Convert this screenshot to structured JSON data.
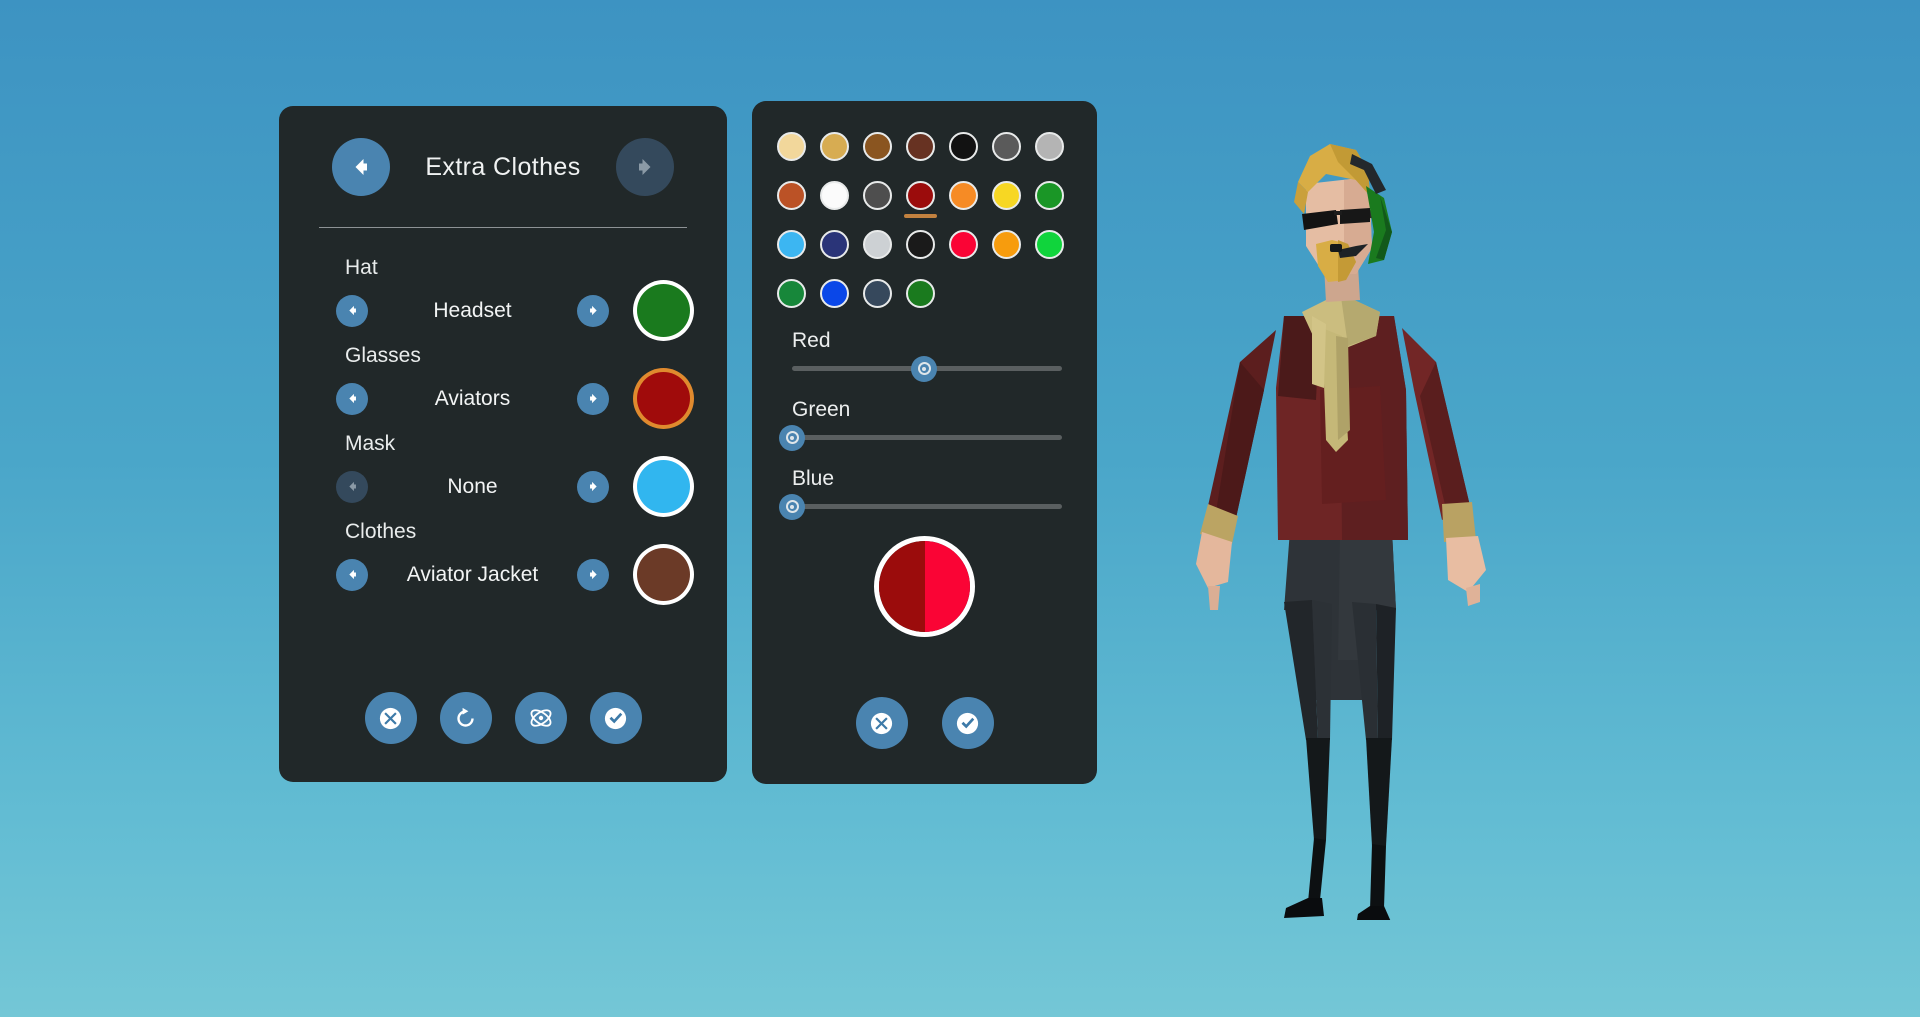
{
  "scene": {
    "background_top": "#3d93c2",
    "background_bottom": "#74c7d6",
    "accent_blue": "#4a84b0",
    "accent_blue_dim": "#34495c",
    "panel_bg": "#212829"
  },
  "clothes_panel": {
    "title": "Extra Clothes",
    "prev_category_icon": "arrow-left-icon",
    "next_category_icon": "arrow-right-icon",
    "prev_category_enabled": true,
    "next_category_enabled": false,
    "groups": [
      {
        "label": "Hat",
        "value": "Headset",
        "swatch": "#1a7a1e",
        "ring": "#ffffff",
        "prev_enabled": true,
        "next_enabled": true
      },
      {
        "label": "Glasses",
        "value": "Aviators",
        "swatch": "#a00b0b",
        "ring": "#e08a2e",
        "prev_enabled": true,
        "next_enabled": true
      },
      {
        "label": "Mask",
        "value": "None",
        "swatch": "#31b6ef",
        "ring": "#ffffff",
        "prev_enabled": false,
        "next_enabled": true
      },
      {
        "label": "Clothes",
        "value": "Aviator Jacket",
        "swatch": "#6b3a27",
        "ring": "#ffffff",
        "prev_enabled": true,
        "next_enabled": true
      }
    ],
    "actions": [
      {
        "name": "cancel-button",
        "icon": "circle-x-icon"
      },
      {
        "name": "reset-button",
        "icon": "refresh-icon"
      },
      {
        "name": "randomize-button",
        "icon": "atom-icon"
      },
      {
        "name": "confirm-button",
        "icon": "circle-check-icon"
      }
    ]
  },
  "color_panel": {
    "palette": [
      "#f2d79b",
      "#d7ac52",
      "#8a5520",
      "#673222",
      "#121212",
      "#5a5a5a",
      "#b4b4b4",
      "#bb5226",
      "#fbfbfb",
      "#4e4e4e",
      "#9b0c0c",
      "#f68b25",
      "#f7d723",
      "#1a9626",
      "#3cb6f2",
      "#2a3478",
      "#cdd1d4",
      "#1a1a1a",
      "#fa0435",
      "#f79c0d",
      "#10d43c",
      "#17873a",
      "#0a47e8",
      "#36485c",
      "#1a7a1e"
    ],
    "selected_index": 10,
    "selection_underline_color": "#c2813f",
    "sliders": [
      {
        "label": "Red",
        "value": 49
      },
      {
        "label": "Green",
        "value": 0
      },
      {
        "label": "Blue",
        "value": 0
      }
    ],
    "preview": {
      "old_color": "#9b0c0c",
      "new_color": "#fa0435"
    },
    "actions": [
      {
        "name": "cancel-button",
        "icon": "circle-x-icon"
      },
      {
        "name": "confirm-button",
        "icon": "circle-check-icon"
      }
    ]
  },
  "character": {
    "hair_color": "#d8ad45",
    "skin_color": "#e0b49b",
    "headset_color": "#1a7a1e",
    "glasses_color": "#111111",
    "jacket_color": "#6e2525",
    "scarf_color": "#cbbd7f",
    "trousers_color": "#2e3338",
    "boots_color": "#0c0f11"
  }
}
